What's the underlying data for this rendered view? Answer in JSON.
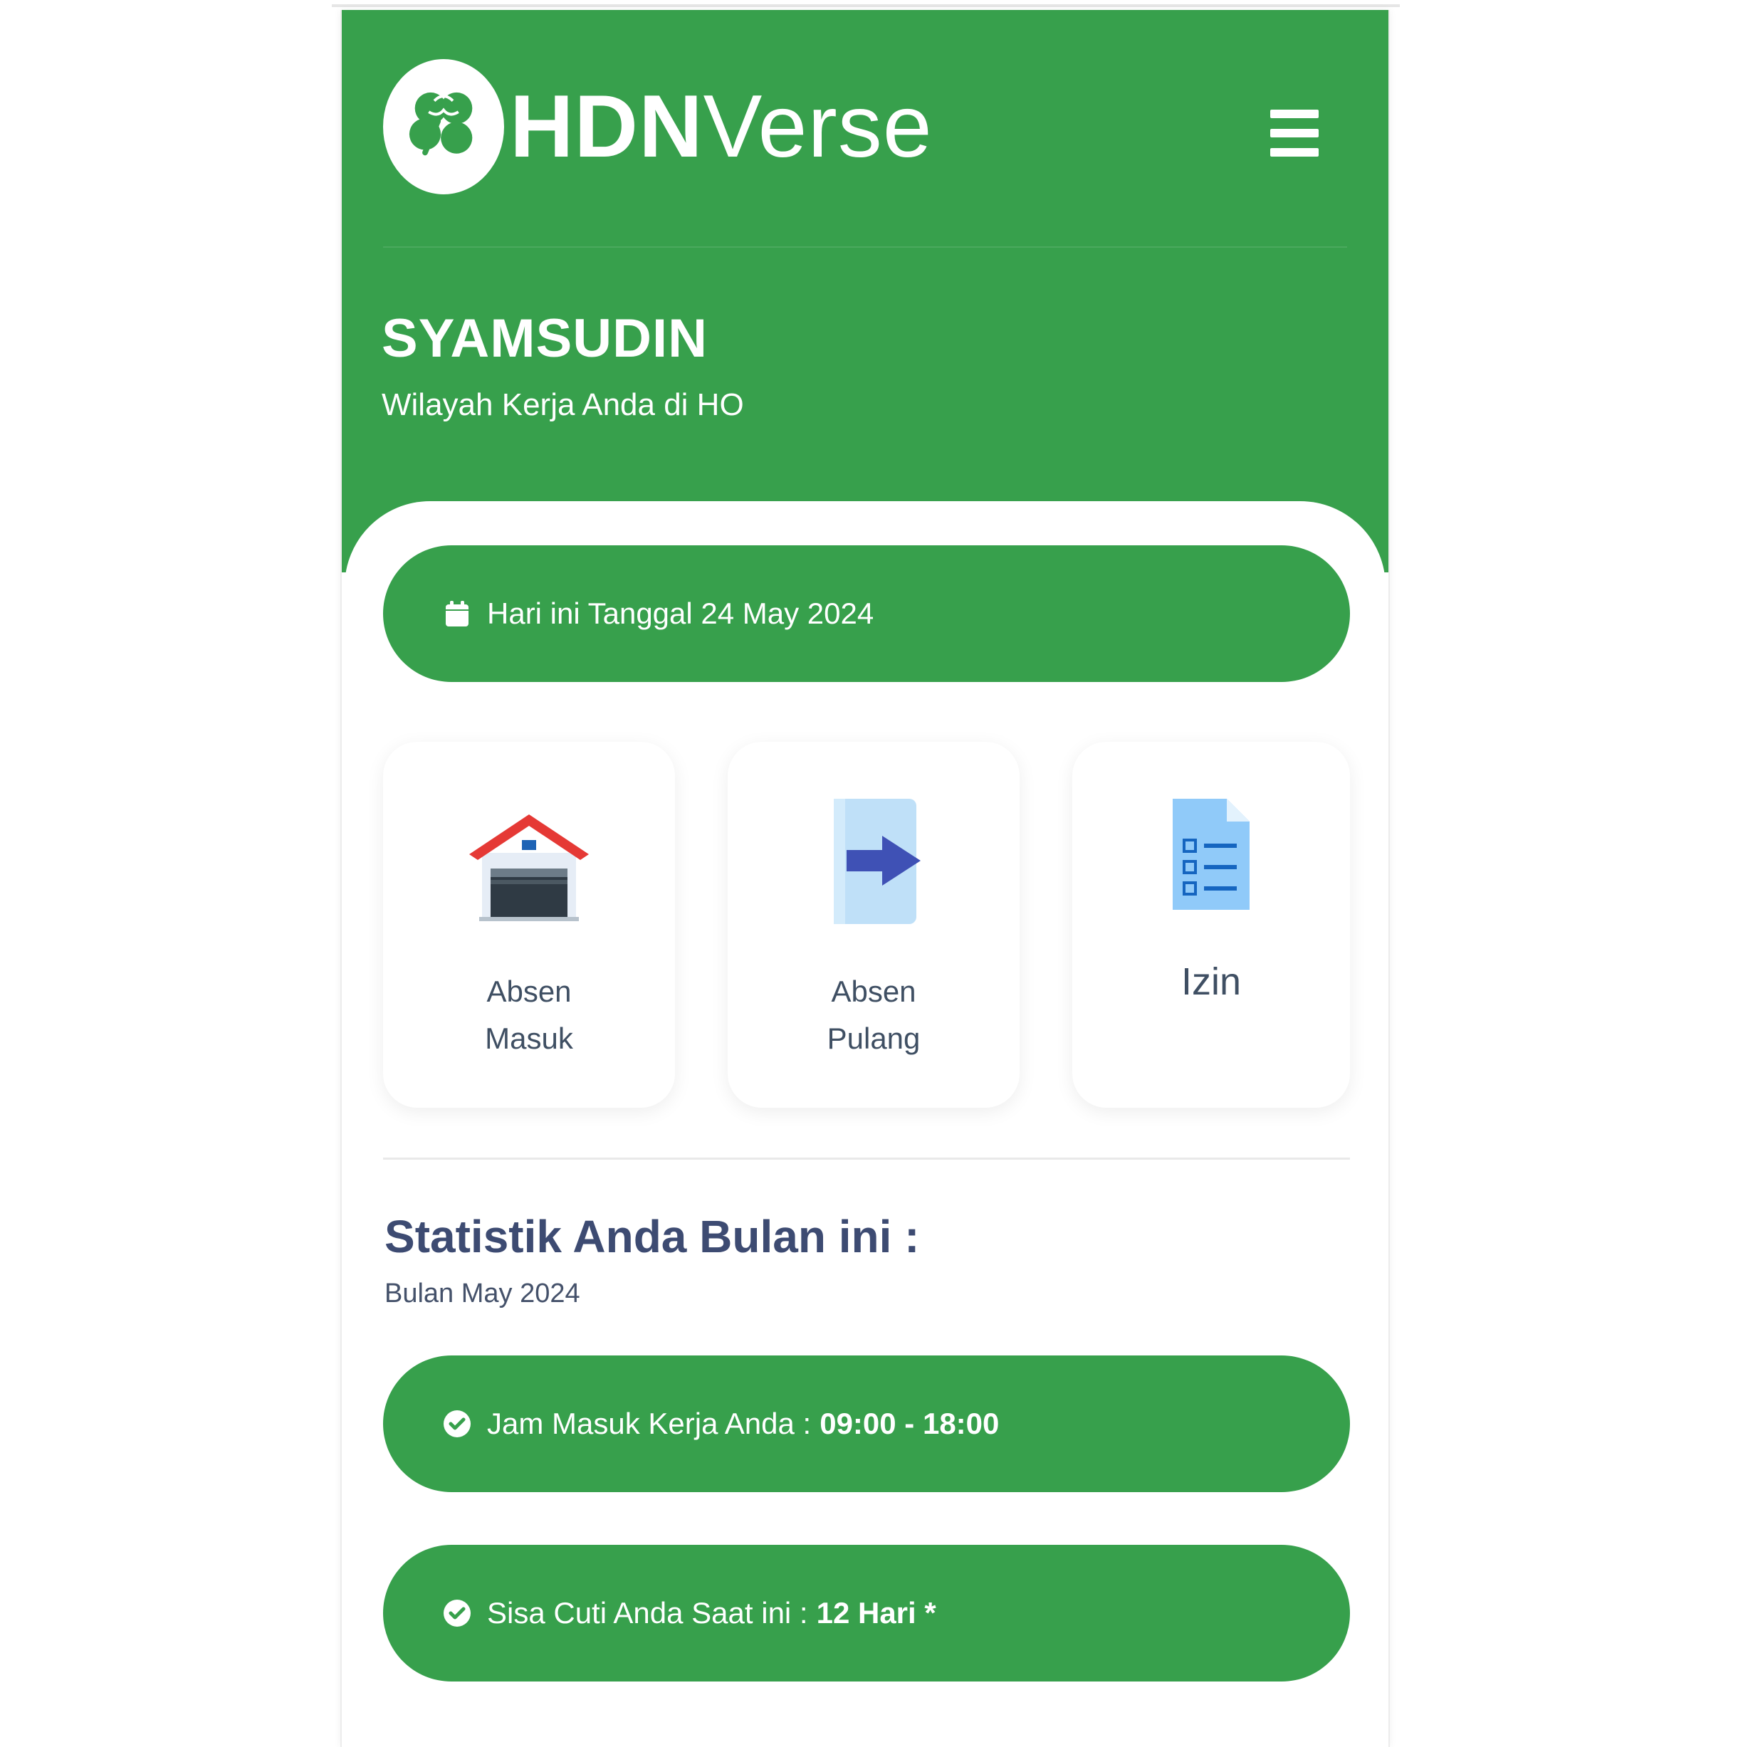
{
  "brand": {
    "logo_text_strong": "HDN",
    "logo_text_light": "Verse",
    "color": "#37a04c"
  },
  "header": {
    "menu_icon": "hamburger-menu-icon",
    "user_name": "SYAMSUDIN",
    "work_area": "Wilayah Kerja Anda di HO"
  },
  "date_banner": {
    "icon": "calendar-icon",
    "text": "Hari ini Tanggal 24 May 2024"
  },
  "actions": [
    {
      "label_line1": "Absen",
      "label_line2": "Masuk",
      "icon": "garage-house-icon"
    },
    {
      "label_line1": "Absen",
      "label_line2": "Pulang",
      "icon": "exit-arrow-icon"
    },
    {
      "label_line1": "Izin",
      "label_line2": "",
      "icon": "checklist-document-icon"
    }
  ],
  "stats": {
    "title": "Statistik Anda Bulan ini :",
    "subtitle": "Bulan May 2024",
    "items": [
      {
        "icon": "check-circle-icon",
        "label": "Jam Masuk Kerja Anda :",
        "value": "09:00 - 18:00"
      },
      {
        "icon": "check-circle-icon",
        "label": "Sisa Cuti Anda Saat ini :",
        "value": "12 Hari *"
      }
    ]
  }
}
